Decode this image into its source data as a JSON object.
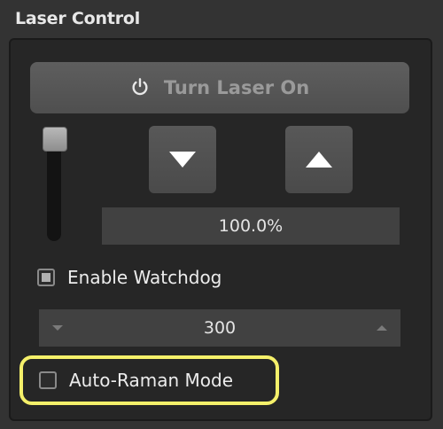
{
  "panel": {
    "title": "Laser Control"
  },
  "laser_button": {
    "label": "Turn Laser On",
    "icon": "power-icon"
  },
  "power": {
    "value_display": "100.0%",
    "slider_level": 1.0
  },
  "watchdog": {
    "label": "Enable Watchdog",
    "checked": true
  },
  "timeout": {
    "value": "300"
  },
  "raman": {
    "label": "Auto-Raman Mode",
    "checked": false
  },
  "colors": {
    "highlight": "#f5f06a",
    "panel_bg": "#262626",
    "button_bg": "#555555"
  }
}
